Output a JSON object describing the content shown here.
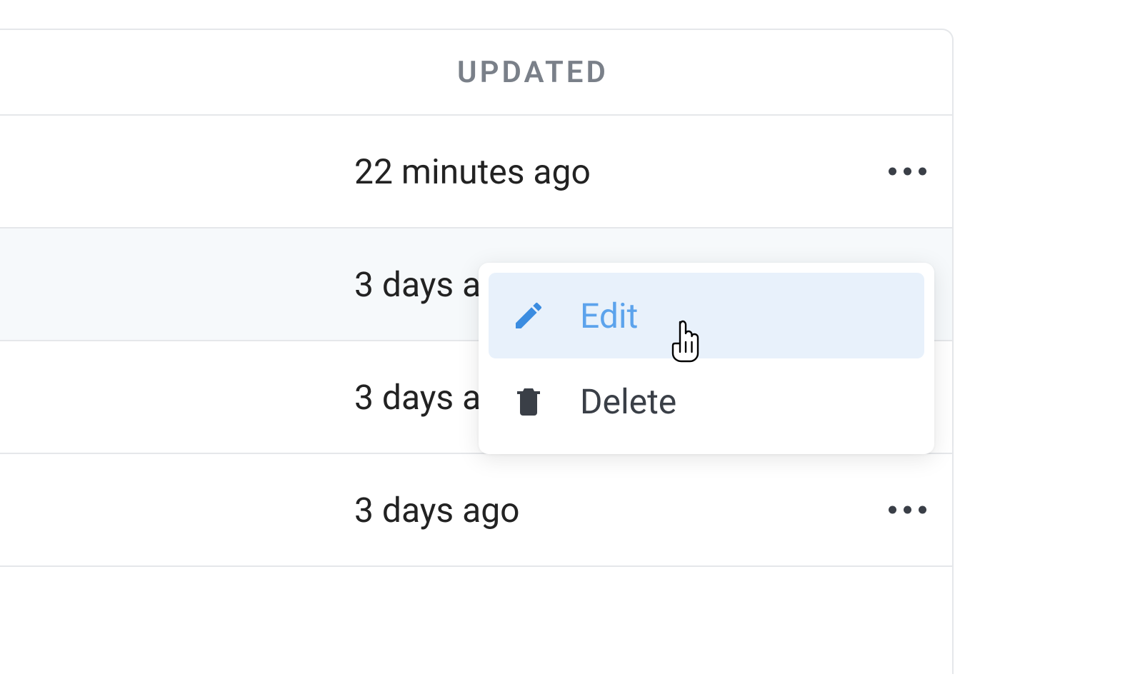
{
  "table": {
    "header": "UPDATED",
    "rows": [
      {
        "updated": "22 minutes ago"
      },
      {
        "updated": "3 days ago"
      },
      {
        "updated": "3 days ago"
      },
      {
        "updated": "3 days ago"
      }
    ]
  },
  "menu": {
    "edit": "Edit",
    "delete": "Delete"
  }
}
